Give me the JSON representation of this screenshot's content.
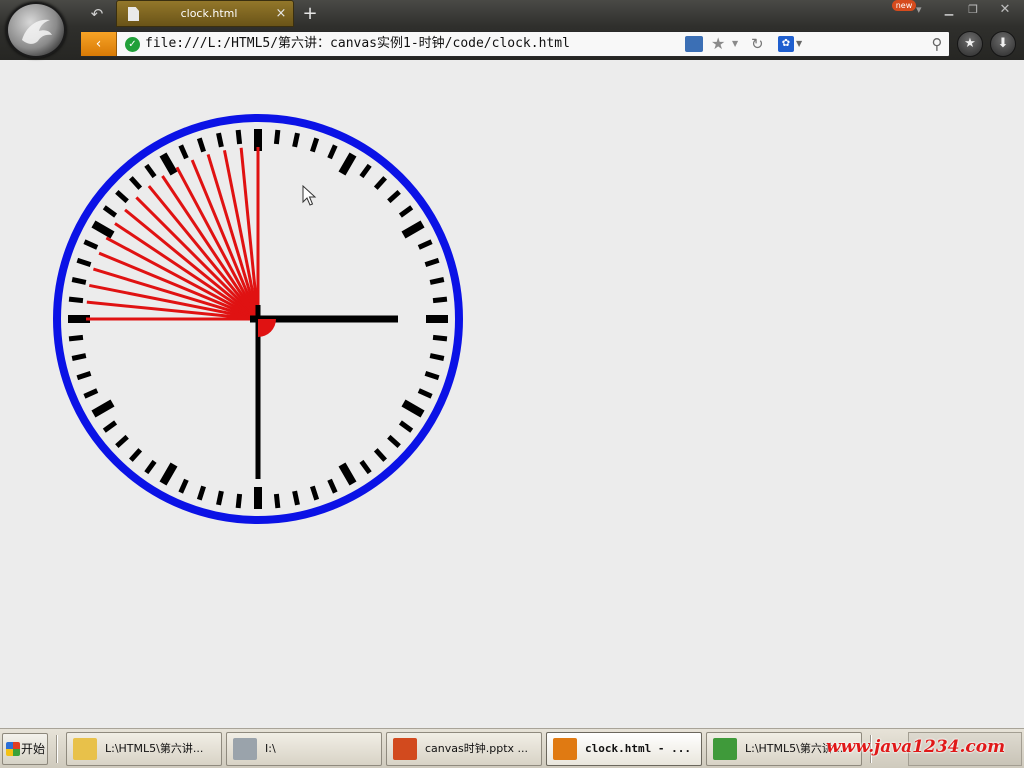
{
  "browser": {
    "tab": {
      "title": "clock.html",
      "close": "×"
    },
    "new_tab": "+",
    "badge": "new",
    "address": "file:///L:/HTML5/第六讲：canvas实例1-时钟/code/clock.html",
    "search_placeholder": ""
  },
  "clock": {
    "ring_color": "#0b12e6",
    "mark_color": "#000000",
    "hand_color": "#000000",
    "sweep_color": "#e01212",
    "hour": 3,
    "minute": 30,
    "sweep_from_minute": 45,
    "sweep_to_minute": 60,
    "sweep_lines": 17
  },
  "taskbar": {
    "start_label": "开始",
    "tasks": [
      {
        "label": "L:\\HTML5\\第六讲...",
        "icon": "folder-icon",
        "icon_color": "#e8c14a"
      },
      {
        "label": "I:\\",
        "icon": "drive-icon",
        "icon_color": "#9aa3ab"
      },
      {
        "label": "canvas时钟.pptx ...",
        "icon": "powerpoint-icon",
        "icon_color": "#d24a1e"
      },
      {
        "label": "clock.html - ...",
        "icon": "browser-icon",
        "icon_color": "#e07a12"
      },
      {
        "label": "L:\\HTML5\\第六讲...",
        "icon": "editor-icon",
        "icon_color": "#3f9a3a"
      }
    ],
    "watermark": "www.java1234.com"
  }
}
